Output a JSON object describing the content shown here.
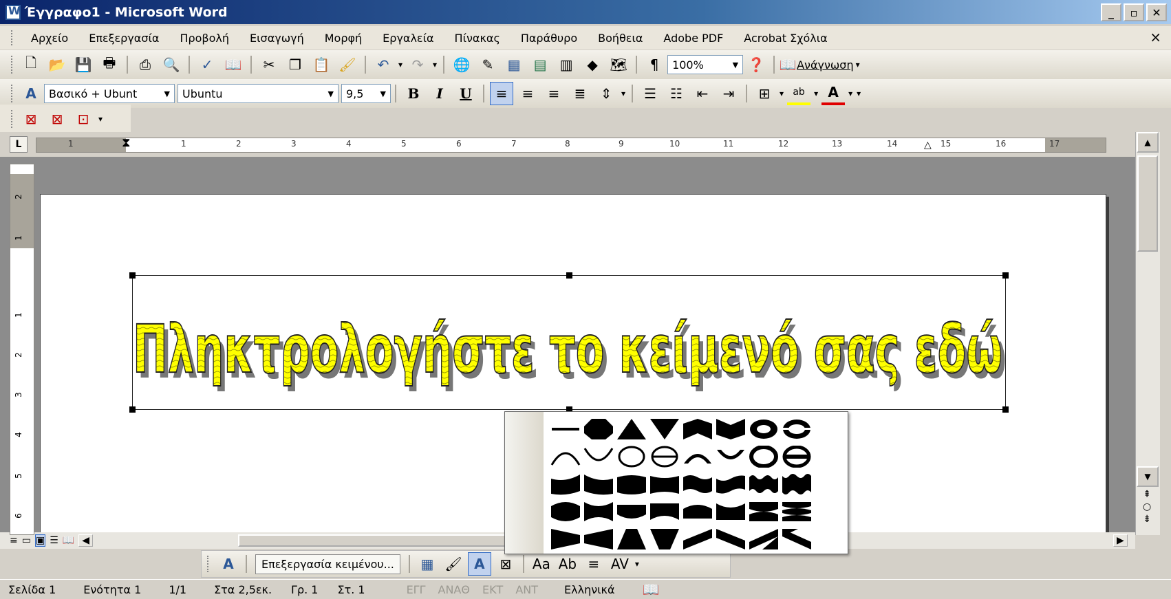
{
  "window": {
    "title": "Έγγραφο1 - Microsoft Word",
    "min": "_",
    "max": "▫",
    "close": "✕"
  },
  "menubar": {
    "items": [
      "Αρχείο",
      "Επεξεργασία",
      "Προβολή",
      "Εισαγωγή",
      "Μορφή",
      "Εργαλεία",
      "Πίνακας",
      "Παράθυρο",
      "Βοήθεια",
      "Adobe PDF",
      "Acrobat Σχόλια"
    ],
    "close_doc": "×"
  },
  "standard_toolbar": {
    "zoom": "100%",
    "reading": "Ανάγνωση"
  },
  "formatting_toolbar": {
    "style": "Βασικό + Ubunt",
    "font": "Ubuntu",
    "size": "9,5",
    "bold": "B",
    "italic": "I",
    "underline": "U"
  },
  "ruler": {
    "tab_selector": "L",
    "h_labels": [
      "1",
      "1",
      "2",
      "3",
      "4",
      "5",
      "6",
      "7",
      "8",
      "9",
      "10",
      "11",
      "12",
      "13",
      "14",
      "15",
      "16",
      "17"
    ],
    "v_labels": [
      "2",
      "1",
      "1",
      "2",
      "3",
      "4",
      "5",
      "6"
    ]
  },
  "document": {
    "wordart_text": "Πληκτρολογήστε το κείμενό σας εδώ",
    "wordart_fill": "#ffff00",
    "wordart_stroke": "#222222",
    "wordart_shadow": "#777777"
  },
  "wordart_toolbar": {
    "edit_text": "Επεξεργασία κειμένου...",
    "same_height": "Aa",
    "vertical": "Ab",
    "spacing": "AV"
  },
  "statusbar": {
    "page": "Σελίδα 1",
    "section": "Ενότητα 1",
    "pages": "1/1",
    "at": "Στα 2,5εκ.",
    "line": "Γρ. 1",
    "col": "Στ. 1",
    "rec": "ΕΓΓ",
    "trk": "ΑΝΑΘ",
    "ext": "ΕΚΤ",
    "ovr": "ΑΝΤ",
    "language": "Ελληνικά"
  }
}
